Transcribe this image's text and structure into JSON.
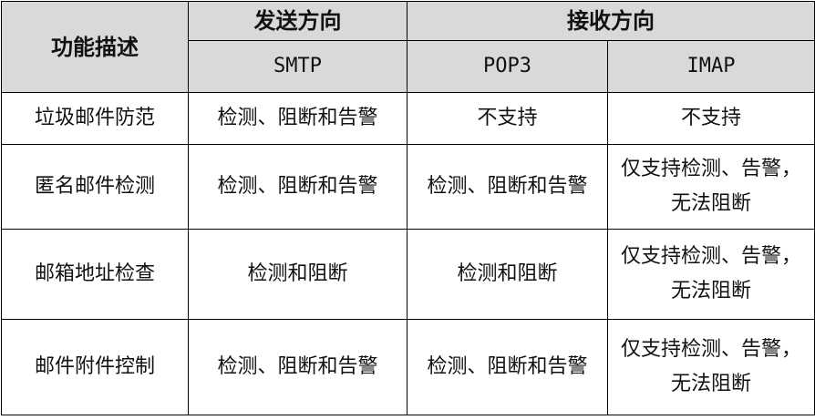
{
  "header": {
    "feature_label": "功能描述",
    "send_group": "发送方向",
    "receive_group": "接收方向",
    "protocols": [
      "SMTP",
      "POP3",
      "IMAP"
    ]
  },
  "rows": [
    {
      "feature": "垃圾邮件防范",
      "smtp": [
        "检测、阻断和告警"
      ],
      "pop3": [
        "不支持"
      ],
      "imap": [
        "不支持"
      ]
    },
    {
      "feature": "匿名邮件检测",
      "smtp": [
        "检测、阻断和告警"
      ],
      "pop3": [
        "检测、阻断和告警"
      ],
      "imap": [
        "仅支持检测、告警，",
        "无法阻断"
      ]
    },
    {
      "feature": "邮箱地址检查",
      "smtp": [
        "检测和阻断"
      ],
      "pop3": [
        "检测和阻断"
      ],
      "imap": [
        "仅支持检测、告警，",
        "无法阻断"
      ]
    },
    {
      "feature": "邮件附件控制",
      "smtp": [
        "检测、阻断和告警"
      ],
      "pop3": [
        "检测、阻断和告警"
      ],
      "imap": [
        "仅支持检测、告警，",
        "无法阻断"
      ]
    }
  ]
}
